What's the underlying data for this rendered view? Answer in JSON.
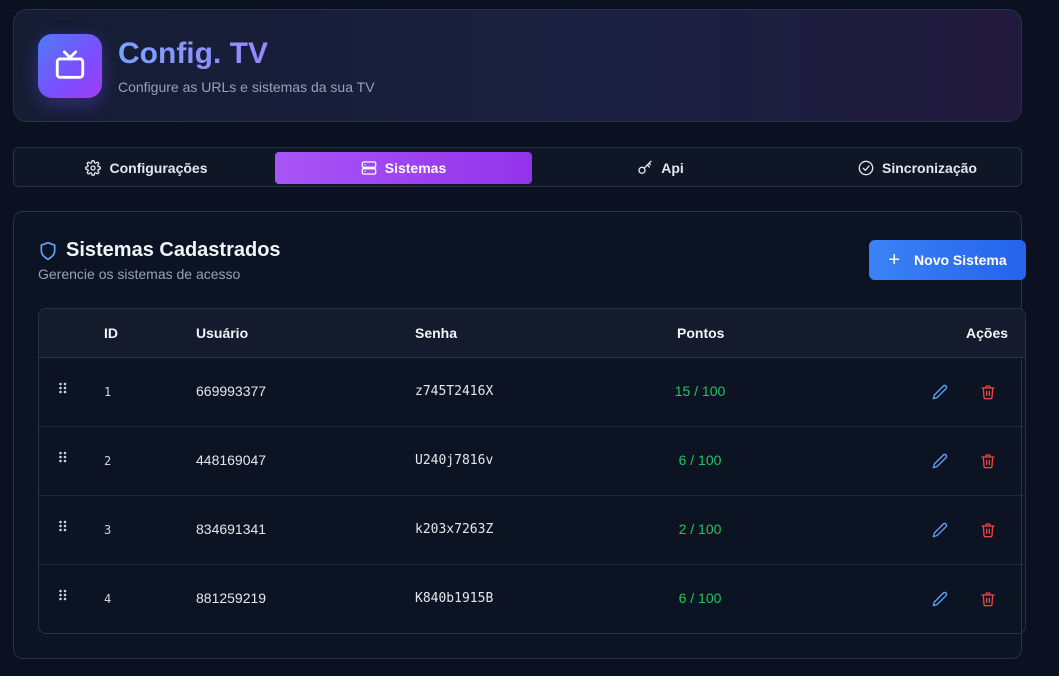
{
  "header": {
    "title": "Config. TV",
    "subtitle": "Configure as URLs e sistemas da sua TV",
    "icon": "tv-icon"
  },
  "tabs": [
    {
      "label": "Configurações",
      "icon": "gear-icon",
      "active": false
    },
    {
      "label": "Sistemas",
      "icon": "server-icon",
      "active": true
    },
    {
      "label": "Api",
      "icon": "key-icon",
      "active": false
    },
    {
      "label": "Sincronização",
      "icon": "check-circle-icon",
      "active": false
    }
  ],
  "section": {
    "title": "Sistemas Cadastrados",
    "subtitle": "Gerencie os sistemas de acesso",
    "icon": "shield-icon",
    "add_button": "Novo Sistema"
  },
  "table": {
    "columns": [
      "ID",
      "Usuário",
      "Senha",
      "Pontos",
      "Ações"
    ],
    "rows": [
      {
        "id": "1",
        "user": "669993377",
        "password": "z745T2416X",
        "points": "15 / 100"
      },
      {
        "id": "2",
        "user": "448169047",
        "password": "U240j7816v",
        "points": "6 / 100"
      },
      {
        "id": "3",
        "user": "834691341",
        "password": "k203x7263Z",
        "points": "2 / 100"
      },
      {
        "id": "4",
        "user": "881259219",
        "password": "K840b1915B",
        "points": "6 / 100"
      }
    ]
  },
  "colors": {
    "accent_purple": "#9333ea",
    "accent_blue": "#3b82f6",
    "points_green": "#22c55e",
    "delete_red": "#ef4444",
    "edit_blue": "#60a5fa"
  }
}
